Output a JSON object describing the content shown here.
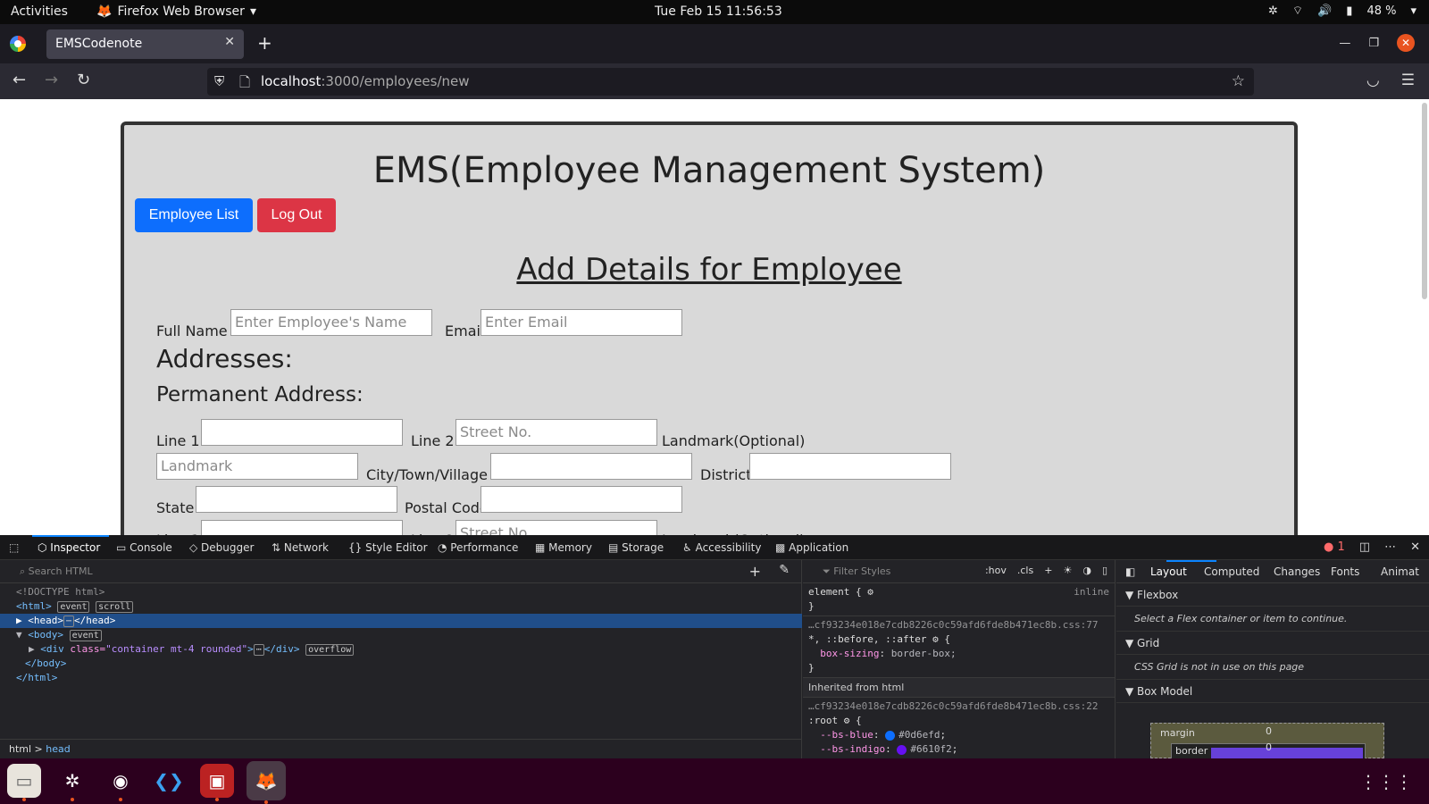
{
  "topbar": {
    "activities": "Activities",
    "app": "Firefox Web Browser",
    "clock": "Tue Feb 15  11:56:53",
    "battery": "48 %"
  },
  "browser": {
    "tab_title": "EMSCodenote",
    "url_host": "localhost",
    "url_path": ":3000/employees/new"
  },
  "page": {
    "title": "EMS(Employee Management System)",
    "btn_list": "Employee List",
    "btn_logout": "Log Out",
    "subtitle": "Add Details for Employee",
    "full_name_label": "Full Name",
    "full_name_ph": "Enter Employee's Name",
    "email_label": "Email",
    "email_ph": "Enter Email",
    "addresses": "Addresses:",
    "permanent": "Permanent Address:",
    "line1": "Line 1",
    "line2": "Line 2",
    "line2_ph": "Street No.",
    "landmark_label": "Landmark(Optional)",
    "landmark_ph": "Landmark",
    "city": "City/Town/Village",
    "district": "District",
    "state": "State",
    "postal": "Postal Code"
  },
  "devtools": {
    "tabs": [
      "Inspector",
      "Console",
      "Debugger",
      "Network",
      "Style Editor",
      "Performance",
      "Memory",
      "Storage",
      "Accessibility",
      "Application"
    ],
    "error_count": "1",
    "search_ph": "Search HTML",
    "filter_ph": "Filter Styles",
    "hov": ":hov",
    "cls": ".cls",
    "tree": {
      "doctype": "<!DOCTYPE html>",
      "html_open": "<html>",
      "head": "<head>",
      "head_close": "</head>",
      "body_open": "<body>",
      "div_open": "<div",
      "class_attr": "class=",
      "class_val": "\"container mt-4 rounded\"",
      "div_close": "</div>",
      "body_close": "</body>",
      "html_close": "</html>",
      "badge_event": "event",
      "badge_scroll": "scroll",
      "badge_overflow": "overflow",
      "ellipsis": "⋯"
    },
    "breadcrumb": [
      "html",
      "head"
    ],
    "rules": {
      "element": "element {",
      "inline": "inline",
      "close": "}",
      "src1": "…cf93234e018e7cdb8226c0c59afd6fde8b471ec8b.css:77",
      "sel1": "*, ::before, ::after",
      "prop1": "box-sizing",
      "val1": "border-box;",
      "inherited": "Inherited from html",
      "src2": "…cf93234e018e7cdb8226c0c59afd6fde8b471ec8b.css:22",
      "root": ":root",
      "vars": [
        {
          "name": "--bs-blue",
          "value": "#0d6efd",
          "color": "#0d6efd"
        },
        {
          "name": "--bs-indigo",
          "value": "#6610f2",
          "color": "#6610f2"
        }
      ]
    },
    "layout_tabs": [
      "Layout",
      "Computed",
      "Changes",
      "Fonts",
      "Animat"
    ],
    "flexbox": "Flexbox",
    "flex_note": "Select a Flex container or item to continue.",
    "grid": "Grid",
    "grid_note": "CSS Grid is not in use on this page",
    "box_model": "Box Model",
    "margin": "margin",
    "border": "border",
    "zero": "0"
  }
}
